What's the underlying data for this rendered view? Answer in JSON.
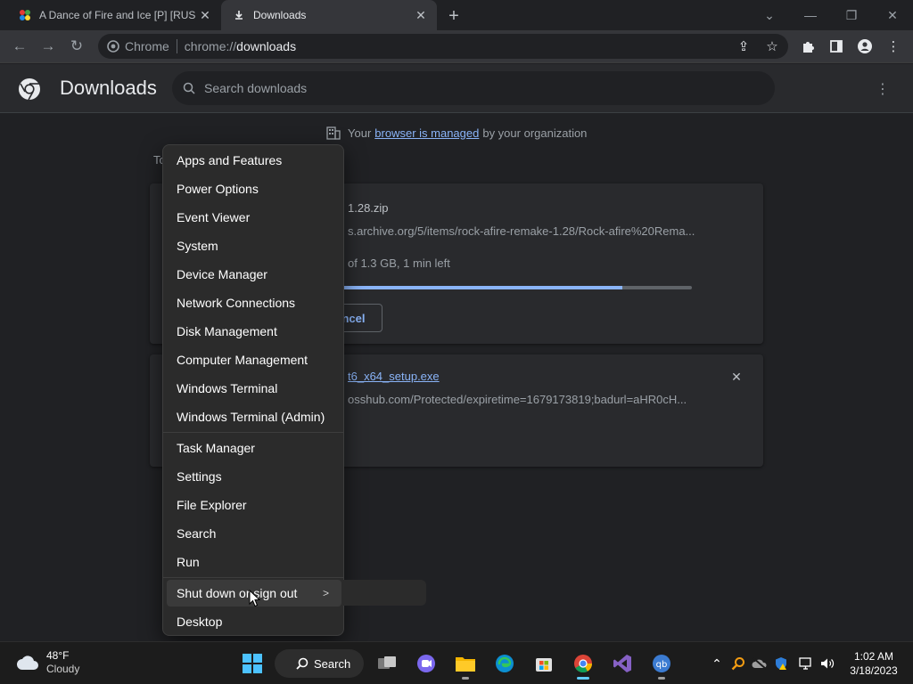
{
  "browser": {
    "tabs": [
      {
        "title": "A Dance of Fire and Ice [P] [RUS",
        "active": false
      },
      {
        "title": "Downloads",
        "active": true
      }
    ],
    "omnibox": {
      "site_label": "Chrome",
      "scheme": "chrome://",
      "host": "downloads"
    }
  },
  "downloads_page": {
    "title": "Downloads",
    "search_placeholder": "Search downloads",
    "managed_notice": {
      "before": "Your",
      "link": "browser is managed",
      "after": "by your organization"
    },
    "section_label": "To",
    "items": [
      {
        "file_name": "1.28.zip",
        "url": "s.archive.org/5/items/rock-afire-remake-1.28/Rock-afire%20Rema...",
        "status": "of 1.3 GB, 1 min left",
        "progress": 0.8,
        "cancel_label": "ncel"
      },
      {
        "file_name": "t6_x64_setup.exe",
        "url": "osshub.com/Protected/expiretime=1679173819;badurl=aHR0cH..."
      }
    ]
  },
  "context_menu": {
    "group1": [
      "Apps and Features",
      "Power Options",
      "Event Viewer",
      "System",
      "Device Manager",
      "Network Connections",
      "Disk Management",
      "Computer Management",
      "Windows Terminal",
      "Windows Terminal (Admin)"
    ],
    "group2": [
      "Task Manager",
      "Settings",
      "File Explorer",
      "Search",
      "Run"
    ],
    "group3": [
      "Shut down or sign out",
      "Desktop"
    ]
  },
  "taskbar": {
    "weather": {
      "temp": "48°F",
      "condition": "Cloudy"
    },
    "search_label": "Search",
    "clock": {
      "time": "1:02 AM",
      "date": "3/18/2023"
    }
  },
  "colors": {
    "accent": "#8ab4f8",
    "taskbar_active": "#60cdff"
  }
}
